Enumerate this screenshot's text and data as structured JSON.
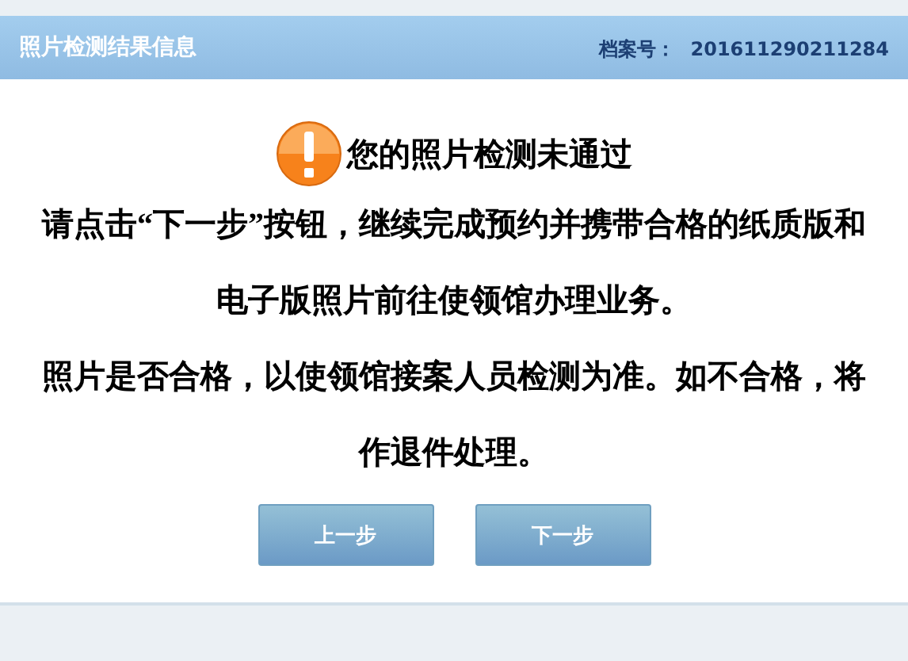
{
  "header": {
    "title": "照片检测结果信息",
    "file_label": "档案号：",
    "file_number": "201611290211284"
  },
  "notice": {
    "heading": "您的照片检测未通过",
    "paragraphs": [
      "请点击“下一步”按钮，继续完成预约并携带合格的纸质版和电子版照片前往使领馆办理业务。",
      "照片是否合格，以使领馆接案人员检测为准。如不合格，将作退件处理。"
    ]
  },
  "buttons": [
    {
      "label": "上一步"
    },
    {
      "label": "下一步"
    }
  ]
}
